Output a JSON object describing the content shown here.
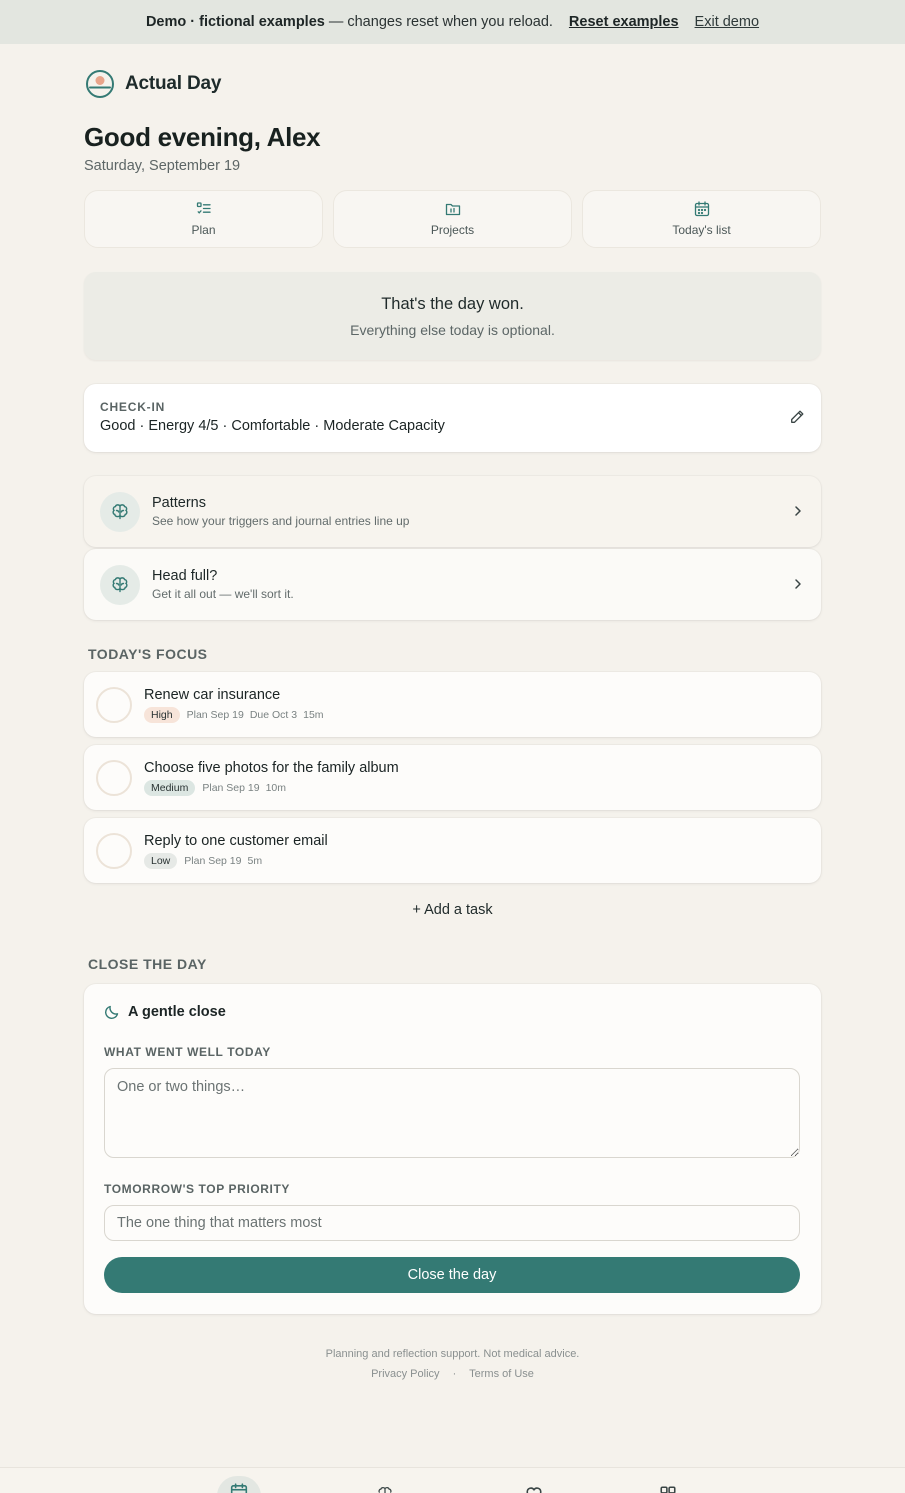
{
  "banner": {
    "strong": "Demo · fictional examples",
    "rest": "— changes reset when you reload.",
    "reset_label": "Reset examples",
    "exit_label": "Exit demo"
  },
  "brand": {
    "name": "Actual Day",
    "icon": "sunrise-logo-icon"
  },
  "greeting": "Good evening, Alex",
  "date": "Saturday, September 19",
  "quicknav": [
    {
      "label": "Plan",
      "icon": "checklist-icon"
    },
    {
      "label": "Projects",
      "icon": "folder-icon"
    },
    {
      "label": "Today's list",
      "icon": "calendar-icon"
    }
  ],
  "won": {
    "title": "That's the day won.",
    "subtitle": "Everything else today is optional."
  },
  "checkin": {
    "label": "CHECK-IN",
    "value": "Good · Energy 4/5 · Comfortable · Moderate Capacity",
    "edit_icon": "pencil-icon"
  },
  "links": [
    {
      "title": "Patterns",
      "subtitle": "See how your triggers and journal entries line up",
      "icon": "brain-icon"
    },
    {
      "title": "Head full?",
      "subtitle": "Get it all out — we'll sort it.",
      "icon": "brain-icon"
    }
  ],
  "focus": {
    "heading": "TODAY'S FOCUS",
    "tasks": [
      {
        "title": "Renew car insurance",
        "priority": "High",
        "meta": [
          "Plan Sep 19",
          "Due Oct 3",
          "15m"
        ]
      },
      {
        "title": "Choose five photos for the family album",
        "priority": "Medium",
        "meta": [
          "Plan Sep 19",
          "10m"
        ]
      },
      {
        "title": "Reply to one customer email",
        "priority": "Low",
        "meta": [
          "Plan Sep 19",
          "5m"
        ]
      }
    ],
    "add_label": "+ Add a task"
  },
  "close": {
    "heading": "CLOSE THE DAY",
    "card_title": "A gentle close",
    "well_label": "WHAT WENT WELL TODAY",
    "well_placeholder": "One or two things…",
    "priority_label": "TOMORROW'S TOP PRIORITY",
    "priority_placeholder": "The one thing that matters most",
    "button": "Close the day"
  },
  "footer": {
    "note": "Planning and reflection support. Not medical advice.",
    "privacy": "Privacy Policy",
    "sep": "·",
    "terms": "Terms of Use"
  },
  "bottomnav": [
    {
      "icon": "calendar-icon",
      "active": true
    },
    {
      "icon": "brain-icon",
      "active": false
    },
    {
      "icon": "heart-icon",
      "active": false
    },
    {
      "icon": "grid-icon",
      "active": false
    }
  ],
  "colors": {
    "accent": "#347a74",
    "background": "#f5f2ec",
    "banner": "#e3e6e0"
  }
}
